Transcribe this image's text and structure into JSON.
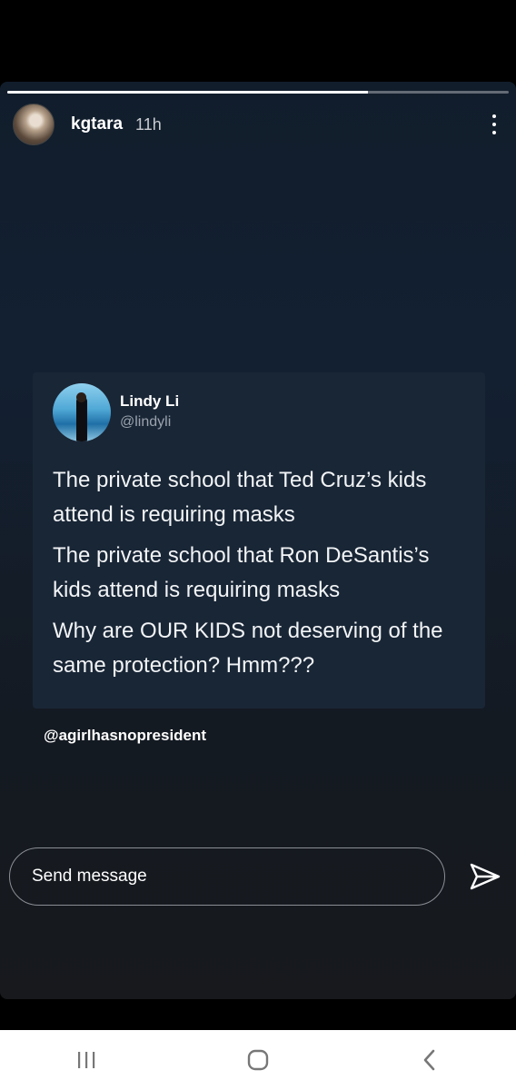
{
  "story": {
    "username": "kgtara",
    "time_ago": "11h",
    "progress": 0.72
  },
  "tweet": {
    "name": "Lindy Li",
    "handle": "@lindyli",
    "paragraphs": [
      "The private school that Ted Cruz’s kids attend is requiring masks",
      "The private school that Ron DeSantis’s kids attend is requiring masks",
      "Why are OUR KIDS not deserving of the same protection? Hmm???"
    ]
  },
  "caption": "@agirlhasnopresident",
  "reply": {
    "placeholder": "Send message"
  },
  "icons": {
    "more": "more-vertical-icon",
    "send": "send-icon",
    "recents": "recents-icon",
    "home": "home-icon",
    "back": "back-icon"
  }
}
